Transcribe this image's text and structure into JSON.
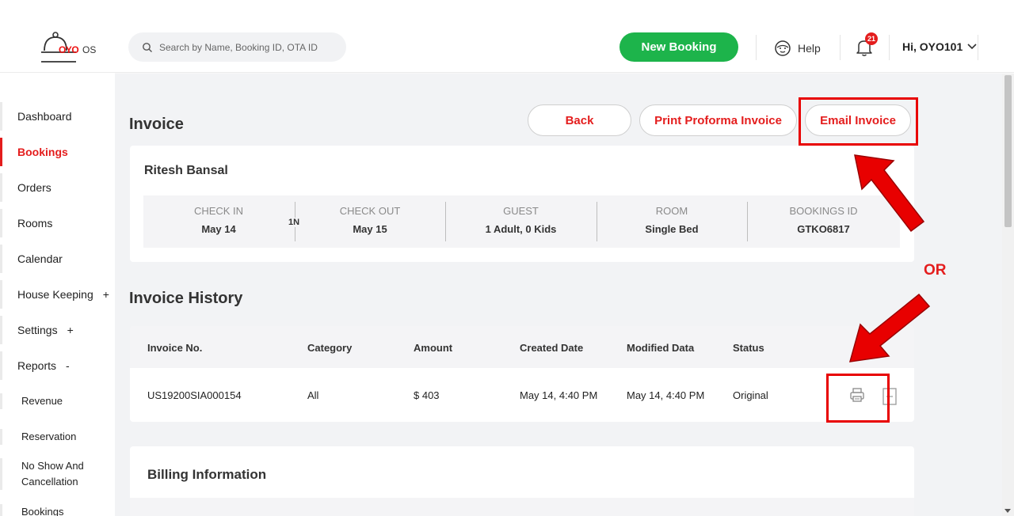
{
  "app": {
    "logo_text": "OYO",
    "logo_suffix": "OS"
  },
  "header": {
    "search_placeholder": "Search by Name, Booking ID, OTA ID",
    "new_booking_label": "New Booking",
    "help_label": "Help",
    "notification_count": "21",
    "user_greeting": "Hi, OYO101"
  },
  "sidebar": {
    "items": [
      {
        "label": "Dashboard"
      },
      {
        "label": "Bookings"
      },
      {
        "label": "Orders"
      },
      {
        "label": "Rooms"
      },
      {
        "label": "Calendar"
      },
      {
        "label": "House Keeping",
        "toggle": "+"
      },
      {
        "label": "Settings",
        "toggle": "+"
      },
      {
        "label": "Reports",
        "toggle": "-"
      }
    ],
    "sub_items": [
      {
        "label": "Revenue"
      },
      {
        "label": "Reservation"
      },
      {
        "label": "No Show And Cancellation"
      },
      {
        "label": "Bookings"
      }
    ],
    "active_item": "Bookings"
  },
  "page": {
    "title": "Invoice",
    "buttons": {
      "back": "Back",
      "print_proforma": "Print Proforma Invoice",
      "email_invoice": "Email Invoice"
    }
  },
  "booking": {
    "guest_name": "Ritesh Bansal",
    "nights": "1N",
    "check_in": {
      "label": "CHECK IN",
      "value": "May 14"
    },
    "check_out": {
      "label": "CHECK OUT",
      "value": "May 15"
    },
    "guest": {
      "label": "GUEST",
      "value": "1 Adult, 0 Kids"
    },
    "room": {
      "label": "ROOM",
      "value": "Single Bed"
    },
    "booking_id": {
      "label": "BOOKINGS ID",
      "value": "GTKO6817"
    }
  },
  "invoice_history": {
    "title": "Invoice History",
    "columns": [
      "Invoice No.",
      "Category",
      "Amount",
      "Created Date",
      "Modified Data",
      "Status"
    ],
    "rows": [
      [
        "US19200SIA000154",
        "All",
        "$ 403",
        "May 14, 4:40 PM",
        "May 14, 4:40 PM",
        "Original"
      ]
    ],
    "row_icons": [
      "printer-icon",
      "document-icon"
    ]
  },
  "billing": {
    "title": "Billing Information"
  },
  "annotations": {
    "or_label": "OR",
    "highlight_color": "#e80000"
  },
  "colors": {
    "brand_red": "#e41d1d",
    "primary_green": "#1db44b",
    "page_bg": "#f2f3f5"
  }
}
